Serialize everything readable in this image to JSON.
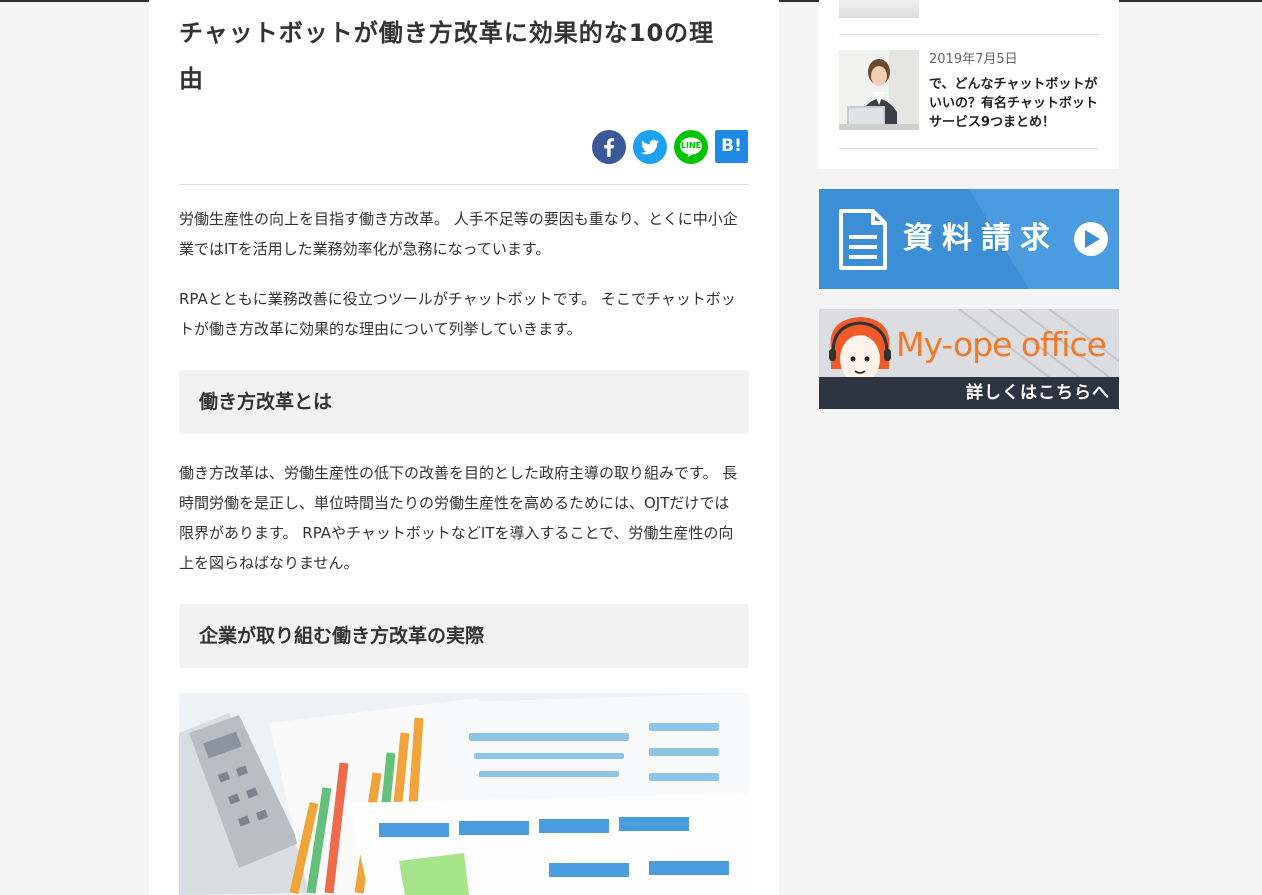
{
  "article": {
    "title": "チャットボットが働き方改革に効果的な10の理由",
    "share": {
      "facebook_icon": "facebook-icon",
      "twitter_icon": "twitter-icon",
      "line_label": "LINE",
      "hatena_label": "B!"
    },
    "paragraphs": [
      "労働生産性の向上を目指す働き方改革。 人手不足等の要因も重なり、とくに中小企業ではITを活用した業務効率化が急務になっています。",
      "RPAとともに業務改善に役立つツールがチャットボットです。 そこでチャットボットが働き方改革に効果的な理由について列挙していきます。",
      "働き方改革は、労働生産性の低下の改善を目的とした政府主導の取り組みです。 長時間労働を是正し、単位時間当たりの労働生産性を高めるためには、OJTだけでは限界があります。 RPAやチャットボットなどITを導入することで、労働生産性の向上を図らねばなりません。"
    ],
    "headings": [
      "働き方改革とは",
      "企業が取り組む働き方改革の実際"
    ]
  },
  "sidebar": {
    "post": {
      "date": "2019年7月5日",
      "title": "で、どんなチャットボットがいいの？有名チャットボットサービス9つまとめ！"
    },
    "banner_request": {
      "label": "資料請求"
    },
    "banner_myope": {
      "brand": "My-ope office",
      "cta": "詳しくはこちらへ"
    }
  },
  "colors": {
    "facebook": "#3b5998",
    "twitter": "#1da1f2",
    "line": "#00c300",
    "hatena": "#1e88e5",
    "request_banner": "#3c8fd6",
    "brand_orange": "#f07a2a"
  }
}
